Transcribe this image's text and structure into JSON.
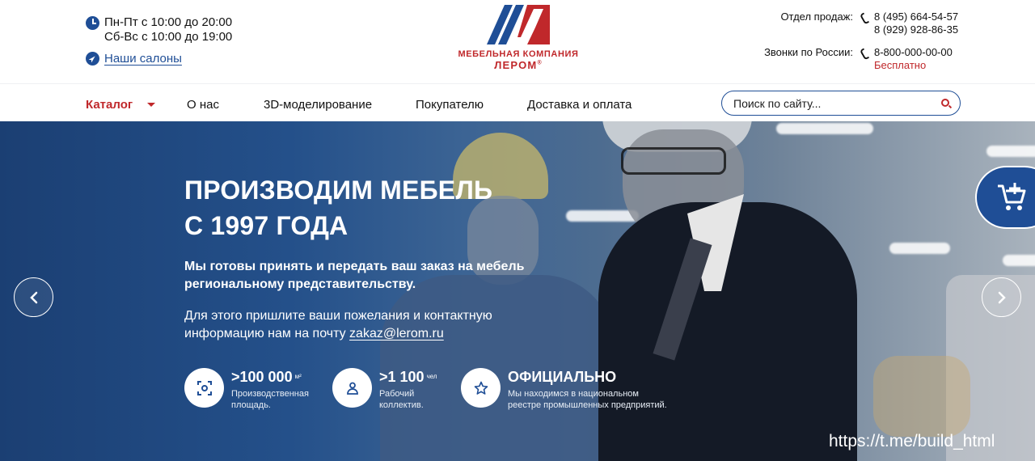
{
  "header": {
    "hours_weekdays": "Пн-Пт с 10:00 до 20:00",
    "hours_weekend": "Сб-Вс с 10:00 до 19:00",
    "salons_link": "Наши салоны",
    "logo_line1": "МЕБЕЛЬНАЯ КОМПАНИЯ",
    "logo_line2": "ЛЕРОМ",
    "logo_mark": "®",
    "sales_label": "Отдел продаж:",
    "sales_phone_1": "8 (495) 664-54-57",
    "sales_phone_2": "8 (929) 928-86-35",
    "russia_label": "Звонки по России:",
    "russia_phone": "8-800-000-00-00",
    "russia_free": "Бесплатно"
  },
  "nav": {
    "items": [
      "Каталог",
      "О нас",
      "3D-моделирование",
      "Покупателю",
      "Доставка и оплата"
    ],
    "search_placeholder": "Поиск по сайту..."
  },
  "hero": {
    "title_line1": "ПРОИЗВОДИМ МЕБЕЛЬ",
    "title_line2": "С 1997 ГОДА",
    "lead": "Мы готовы принять и передать ваш  заказ на мебель региональному представительству.",
    "sub_text": "Для этого пришлите ваши пожелания и контактную информацию нам на почту ",
    "email": "zakaz@lerom.ru",
    "stats": [
      {
        "value": ">100 000",
        "unit": "м²",
        "desc_1": "Производственная",
        "desc_2": "площадь."
      },
      {
        "value": ">1 100",
        "unit": "чел",
        "desc_1": "Рабочий",
        "desc_2": "коллектив."
      },
      {
        "value": "ОФИЦИАЛЬНО",
        "unit": "",
        "desc_1": "Мы находимся в национальном",
        "desc_2": "реестре промышленных предприятий."
      }
    ]
  },
  "watermark": "https://t.me/build_html",
  "colors": {
    "brand_blue": "#1f4e96",
    "brand_red": "#c0282b"
  }
}
